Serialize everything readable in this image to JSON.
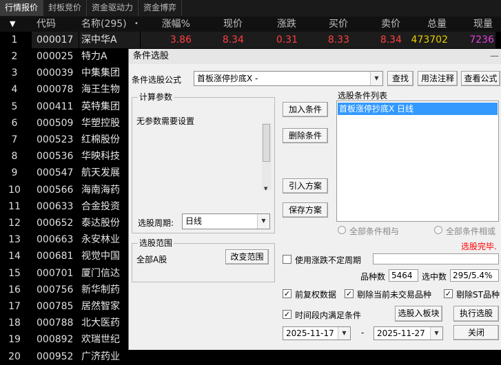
{
  "tabs": [
    {
      "label": "行情报价",
      "active": true
    },
    {
      "label": "封板竞价",
      "active": false
    },
    {
      "label": "资金驱动力",
      "active": false
    },
    {
      "label": "资金博弈",
      "active": false
    }
  ],
  "table": {
    "headers": {
      "sort_marker": "▼",
      "code": "代码",
      "name": "名称(295)",
      "dot": "•",
      "pct": "涨幅%",
      "price": "现价",
      "change": "涨跌",
      "bid": "买价",
      "ask": "卖价",
      "volume": "总量",
      "now_vol": "现量"
    },
    "first_row": {
      "num": "1",
      "code": "000017",
      "name": "深中华A",
      "pct": "3.86",
      "price": "8.34",
      "change": "0.31",
      "bid": "8.33",
      "ask": "8.34",
      "volume": "473702",
      "now_vol": "7236"
    },
    "rows": [
      {
        "num": "2",
        "code": "000025",
        "name": "特力A"
      },
      {
        "num": "3",
        "code": "000039",
        "name": "中集集团"
      },
      {
        "num": "4",
        "code": "000078",
        "name": "海王生物"
      },
      {
        "num": "5",
        "code": "000411",
        "name": "英特集团"
      },
      {
        "num": "6",
        "code": "000509",
        "name": "华塑控股"
      },
      {
        "num": "7",
        "code": "000523",
        "name": "红棉股份"
      },
      {
        "num": "8",
        "code": "000536",
        "name": "华映科技"
      },
      {
        "num": "9",
        "code": "000547",
        "name": "航天发展"
      },
      {
        "num": "10",
        "code": "000566",
        "name": "海南海药"
      },
      {
        "num": "11",
        "code": "000633",
        "name": "合金投资"
      },
      {
        "num": "12",
        "code": "000652",
        "name": "泰达股份"
      },
      {
        "num": "13",
        "code": "000663",
        "name": "永安林业"
      },
      {
        "num": "14",
        "code": "000681",
        "name": "视觉中国"
      },
      {
        "num": "15",
        "code": "000701",
        "name": "厦门信达"
      },
      {
        "num": "16",
        "code": "000756",
        "name": "新华制药"
      },
      {
        "num": "17",
        "code": "000785",
        "name": "居然智家"
      },
      {
        "num": "18",
        "code": "000788",
        "name": "北大医药"
      },
      {
        "num": "19",
        "code": "000892",
        "name": "欢瑞世纪"
      },
      {
        "num": "20",
        "code": "000952",
        "name": "广济药业"
      }
    ]
  },
  "colors": {
    "red": "#ff4040",
    "yellow": "#e6d000",
    "magenta": "#e040e0",
    "row_highlight": "#1c1c1c"
  },
  "dialog": {
    "title": "条件选股",
    "close": "—",
    "formula_label": "条件选股公式",
    "formula_value": "首板涨停抄底X  -",
    "find_btn": "查找",
    "usage_btn": "用法注释",
    "view_btn": "查看公式",
    "params_title": "计算参数",
    "params_text": "无参数需要设置",
    "period_label": "选股周期:",
    "period_value": "日线",
    "add_btn": "加入条件",
    "del_btn": "删除条件",
    "import_btn": "引入方案",
    "save_btn": "保存方案",
    "list_title": "选股条件列表",
    "list_items": [
      "首板涨停抄底X  日线"
    ],
    "radio_and": "全部条件相与",
    "radio_or": "全部条件相或",
    "status": "选股完毕.",
    "range_title": "选股范围",
    "range_value": "全部A股",
    "change_range_btn": "改变范围",
    "use_uncertain": "使用涨跌不定周期",
    "count_label": "品种数",
    "count_value": "5464",
    "selected_label": "选中数",
    "selected_value": "295/5.4%",
    "cb_restore": "前复权数据",
    "cb_remove_suspended": "剔除当前未交易品种",
    "cb_remove_st": "剔除ST品种",
    "cb_time": "时间段内满足条件",
    "to_block_btn": "选股入板块",
    "run_btn": "执行选股",
    "date_from": "2025-11-17",
    "date_sep": "-",
    "date_to": "2025-11-27",
    "close_btn": "关闭"
  }
}
